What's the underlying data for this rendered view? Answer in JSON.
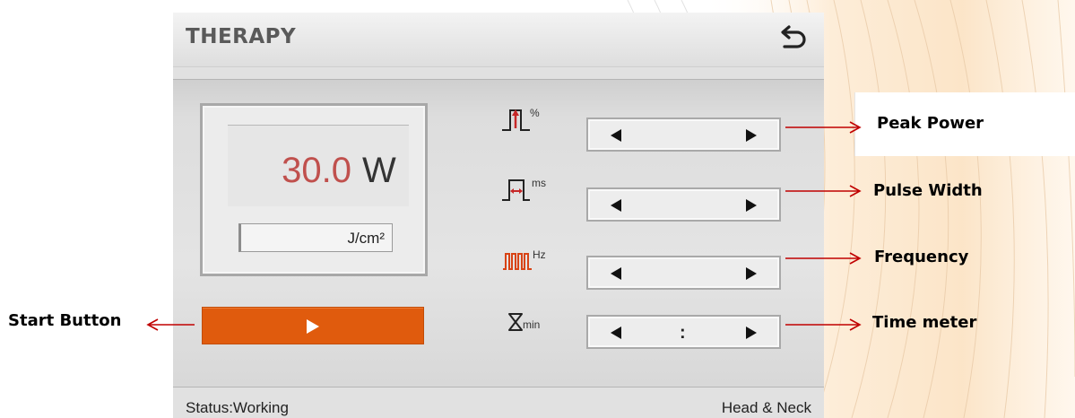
{
  "screen": {
    "title": "THERAPY",
    "power_value": "30.0",
    "power_unit": "W",
    "energy_unit": "J/cm²",
    "params": [
      {
        "icon": "peak-power-icon",
        "unit": "%"
      },
      {
        "icon": "pulse-width-icon",
        "unit": "ms"
      },
      {
        "icon": "frequency-icon",
        "unit": "Hz"
      },
      {
        "icon": "hourglass-icon",
        "unit": "min"
      }
    ],
    "time_separator": ":",
    "status": "Status:Working",
    "mode": "Head & Neck"
  },
  "annotations": {
    "peak_power": "Peak Power",
    "pulse_width": "Pulse Width",
    "frequency": "Frequency",
    "time_meter": "Time meter",
    "start_button": "Start Button"
  },
  "colors": {
    "accent_orange": "#e05b0d",
    "power_red": "#c0504d",
    "annotation_arrow": "#c00000"
  }
}
